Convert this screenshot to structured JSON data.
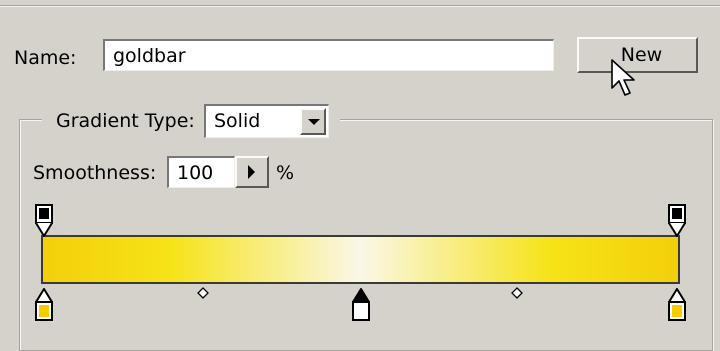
{
  "name": {
    "label": "Name:",
    "value": "goldbar"
  },
  "new_button": {
    "label": "New"
  },
  "gradient_type": {
    "label": "Gradient Type:",
    "selected": "Solid"
  },
  "smoothness": {
    "label": "Smoothness:",
    "value": "100",
    "unit": "%"
  },
  "gradient": {
    "colors": {
      "gold": "#f3cf0b",
      "yellow": "#f6e317",
      "cream": "#faf7e8",
      "stop_fill": "#f5cc00",
      "stop_selected_fill": "#ffffff",
      "opacity_fill": "#000000"
    }
  },
  "icons": [
    "cursor-arrow-icon",
    "dropdown-arrow-icon",
    "play-arrow-icon"
  ]
}
